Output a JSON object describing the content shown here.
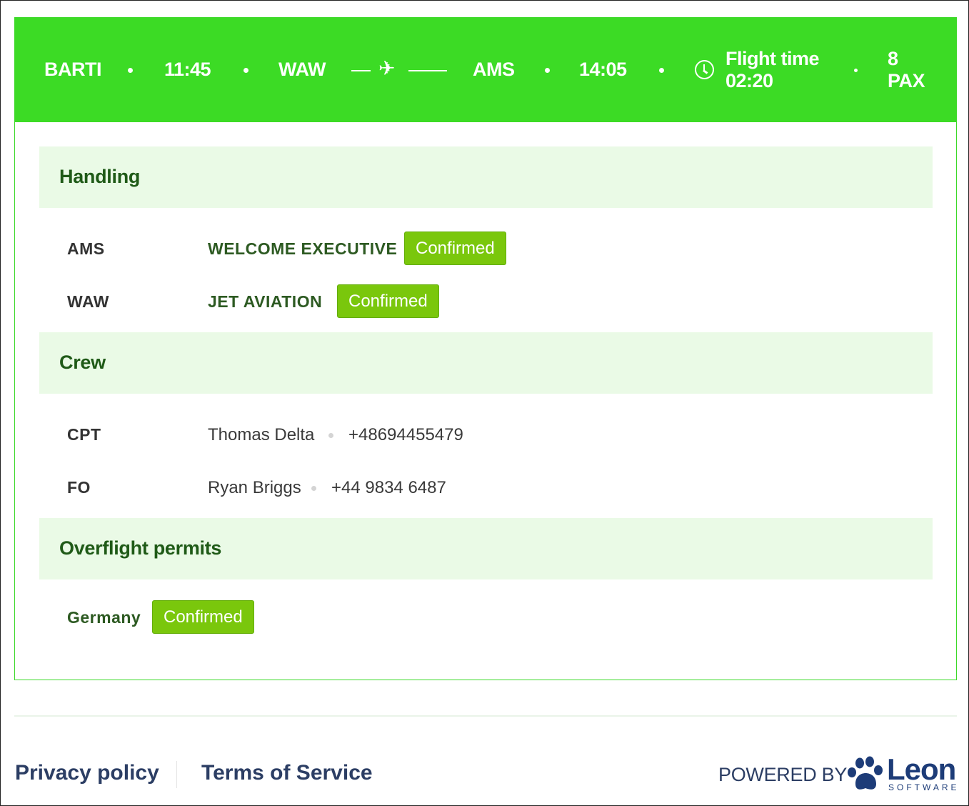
{
  "header": {
    "callsign": "BARTI",
    "departure_time": "11:45",
    "origin": "WAW",
    "plane_icon": "✈",
    "destination": "AMS",
    "arrival_time": "14:05",
    "flight_time_label": "Flight time",
    "flight_time_value": "02:20",
    "pax_count": "8",
    "pax_label": "PAX",
    "icons": {
      "plane": "plane-icon",
      "clock": "clock-icon"
    },
    "background_color": "#3cdb25"
  },
  "handling": {
    "title": "Handling",
    "items": [
      {
        "airport": "AMS",
        "handler": "WELCOME EXECUTIVE",
        "status": "Confirmed"
      },
      {
        "airport": "WAW",
        "handler": "JET AVIATION",
        "status": "Confirmed"
      }
    ]
  },
  "crew": {
    "title": "Crew",
    "members": [
      {
        "role": "CPT",
        "name": "Thomas Delta",
        "phone": "+48694455479"
      },
      {
        "role": "FO",
        "name": "Ryan Briggs",
        "phone": "+44 9834 6487"
      }
    ]
  },
  "permits": {
    "title": "Overflight permits",
    "items": [
      {
        "country": "Germany",
        "status": "Confirmed"
      }
    ]
  },
  "footer": {
    "privacy_label": "Privacy policy",
    "terms_label": "Terms of Service",
    "powered_by": "POWERED BY",
    "logo_word": "Leon",
    "logo_sub": "SOFTWARE"
  },
  "colors": {
    "badge": "#7ac70c",
    "section_bg": "#eafae6",
    "section_title": "#1f5a17",
    "link": "#2c3e64",
    "logo": "#1d3c78"
  }
}
